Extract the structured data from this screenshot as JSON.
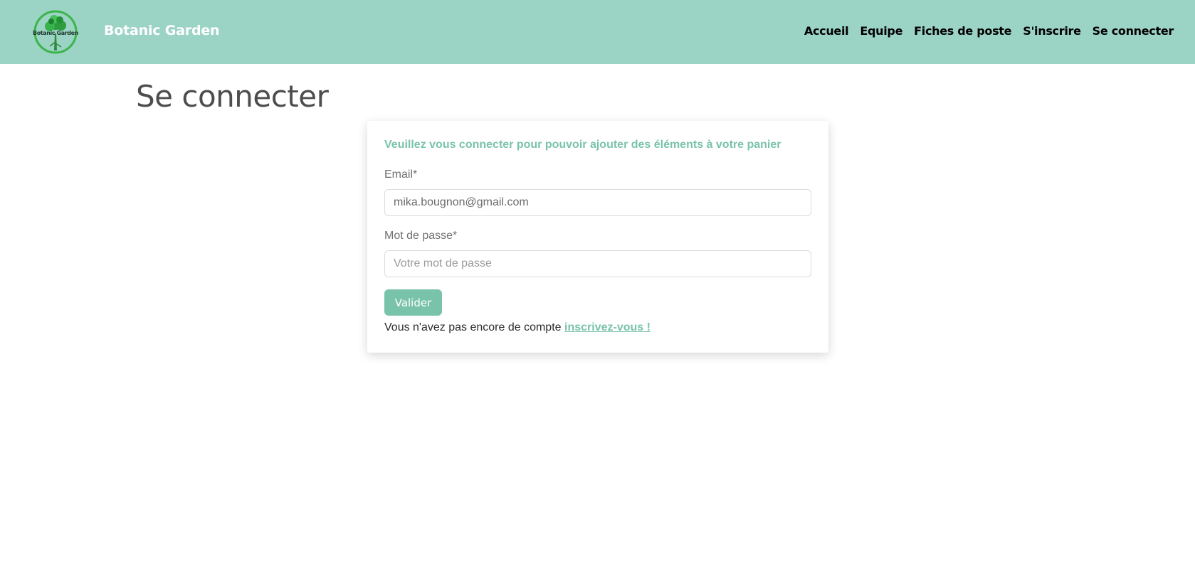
{
  "navbar": {
    "logo_text": "Botanic Garden",
    "brand": "Botanic Garden",
    "links": [
      "Accueil",
      "Equipe",
      "Fiches de poste",
      "S'inscrire",
      "Se connecter"
    ]
  },
  "page": {
    "title": "Se connecter"
  },
  "login": {
    "heading": "Veuillez vous connecter pour pouvoir ajouter des éléments à votre panier",
    "email_label": "Email*",
    "email_value": "mika.bougnon@gmail.com",
    "password_label": "Mot de passe*",
    "password_placeholder": "Votre mot de passe",
    "submit_label": "Valider",
    "signup_prompt": "Vous n'avez pas encore de compte",
    "signup_link": "inscrivez-vous !"
  },
  "colors": {
    "navbar_bg": "#9bd3c4",
    "accent": "#79c3aa",
    "brand_text": "#ffffff",
    "title_text": "#4d4d4d"
  },
  "icons": {
    "logo": "tree-logo-icon"
  }
}
